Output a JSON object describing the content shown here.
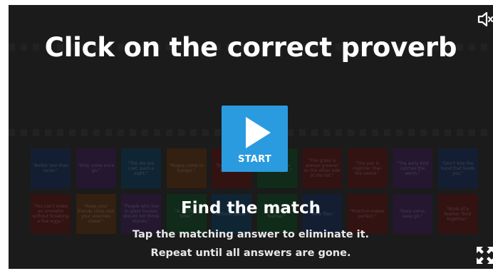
{
  "game": {
    "title": "Click on the correct proverb",
    "start_label": "START",
    "subtitle": "Find the match",
    "instruction_line1": "Tap the matching answer to eliminate it.",
    "instruction_line2": "Repeat until all answers are gone."
  },
  "cards": [
    {
      "text": "\"Better late than never.\"",
      "color": "#152a5a"
    },
    {
      "text": "\"Only come once go.\"",
      "color": "#3a1c52"
    },
    {
      "text": "\"The die are cast, such a sight.\"",
      "color": "#0c3b5c"
    },
    {
      "text": "\"Rogue come in hunger.\"",
      "color": "#5c2f0c"
    },
    {
      "text": "\"Don't cry over spilt milk.\"",
      "color": "#5a1010"
    },
    {
      "text": "\"Don't come there to you.\"",
      "color": "#0f4723"
    },
    {
      "text": "\"The grass is always greener on the other side of the hill.\"",
      "color": "#5a1010"
    },
    {
      "text": "\"The pen is mightier than the sword.\"",
      "color": "#5a1010"
    },
    {
      "text": "\"The early bird catches the worm.\"",
      "color": "#3a1c52"
    },
    {
      "text": "\"Don't bite the hand that feeds you.\"",
      "color": "#152a5a"
    },
    {
      "text": "\"You can't make an omelette without breaking a few eggs.\"",
      "color": "#5a1010"
    },
    {
      "text": "\"Keep your friends close and your enemies closer.\"",
      "color": "#5c2f0c"
    },
    {
      "text": "\"People who live in glass houses should not throw stones.\"",
      "color": "#3a1c52"
    },
    {
      "text": "\"A stitch in time.\"",
      "color": "#0f4723"
    },
    {
      "text": "\"Actions speak.\"",
      "color": "#0c3b5c"
    },
    {
      "text": "\"Birds of a feather.\"",
      "color": "#0f4723"
    },
    {
      "text": "\"Time flies.\"",
      "color": "#152a5a"
    },
    {
      "text": "\"Practice makes perfect.\"",
      "color": "#5a1010"
    },
    {
      "text": "\"Easy come, easy go.\"",
      "color": "#3a1c52"
    },
    {
      "text": "\"Birds of a feather flock together.\"",
      "color": "#5a1010"
    }
  ],
  "icons": {
    "sound": "speaker-muted-icon",
    "fullscreen": "fullscreen-icon"
  }
}
